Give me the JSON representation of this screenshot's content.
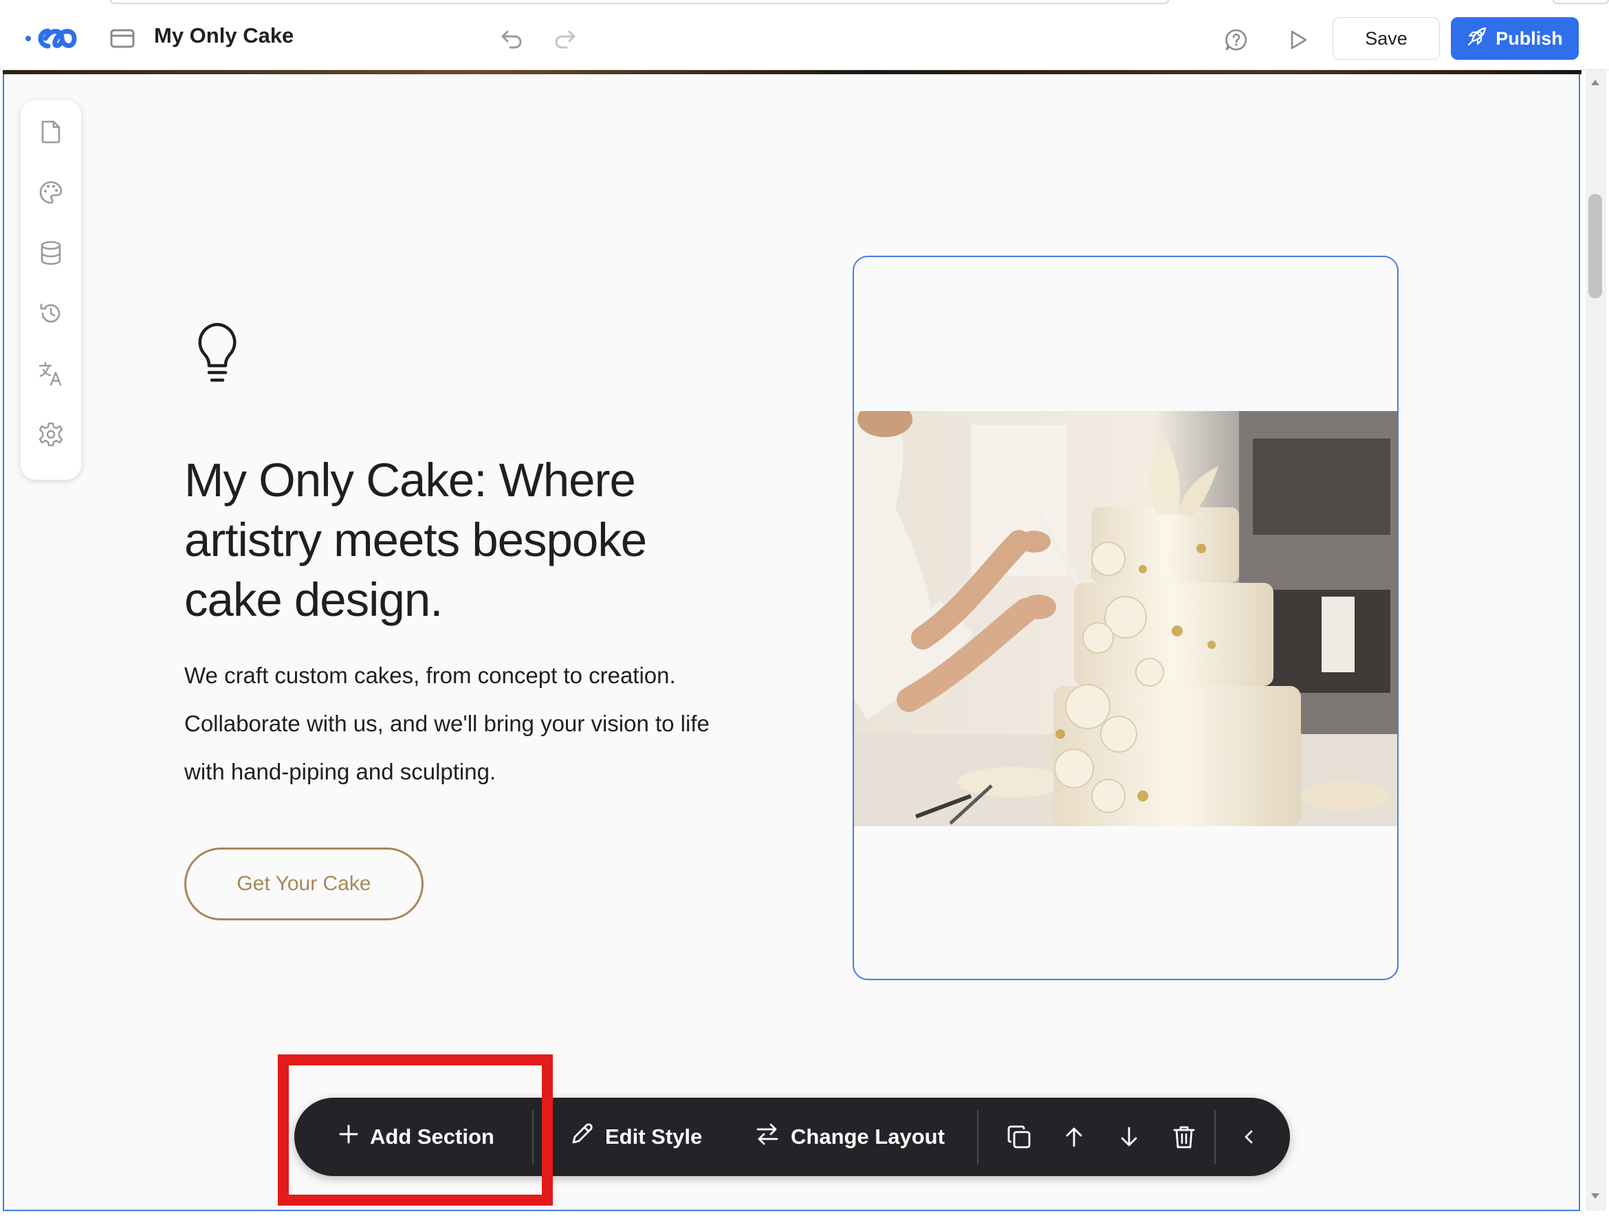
{
  "app": {
    "title": "My Only Cake",
    "logo_icon": "app-logo-icon",
    "page_icon": "browser-window-icon"
  },
  "topbar": {
    "undo_icon": "undo-icon",
    "redo_icon": "redo-icon",
    "comment_icon": "comment-help-icon",
    "preview_icon": "play-preview-icon",
    "save_label": "Save",
    "publish_label": "Publish",
    "publish_icon": "rocket-icon",
    "publish_color": "#2f6fec"
  },
  "rail": {
    "items": [
      {
        "icon": "page-icon",
        "name": "Pages"
      },
      {
        "icon": "palette-icon",
        "name": "Theme"
      },
      {
        "icon": "database-icon",
        "name": "Data"
      },
      {
        "icon": "history-icon",
        "name": "History"
      },
      {
        "icon": "translate-icon",
        "name": "Translate"
      },
      {
        "icon": "gear-icon",
        "name": "Settings"
      }
    ]
  },
  "hero": {
    "icon": "lightbulb-icon",
    "heading": "My Only Cake: Where artistry meets bespoke cake design.",
    "body": "We craft custom cakes, from concept to creation. Collaborate with us, and we'll bring your vision to life with hand-piping and sculpting.",
    "cta_label": "Get Your Cake",
    "accent_color": "#a8875a",
    "image_alt": "Baker decorating a white tiered cake with sugar flowers"
  },
  "toolbar": {
    "add_section_label": "Add Section",
    "edit_style_label": "Edit Style",
    "change_layout_label": "Change Layout",
    "icons": [
      "plus-icon",
      "pencil-icon",
      "swap-arrows-icon",
      "duplicate-icon",
      "arrow-up-icon",
      "arrow-down-icon",
      "trash-icon",
      "chevron-left-icon"
    ],
    "highlight_color": "#e31b1b"
  },
  "selection_color": "#4c7be0"
}
